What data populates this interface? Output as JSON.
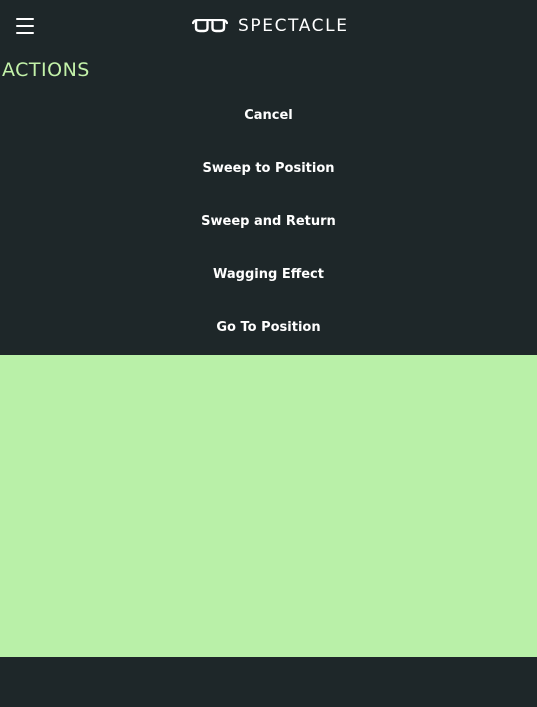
{
  "header": {
    "brand_name": "SPECTACLE",
    "menu_icon": "hamburger-menu-icon",
    "logo_icon": "glasses-logo-icon"
  },
  "section": {
    "title": "ACTIONS"
  },
  "actions": [
    {
      "label": "Cancel"
    },
    {
      "label": "Sweep to Position"
    },
    {
      "label": "Sweep and Return"
    },
    {
      "label": "Wagging Effect"
    },
    {
      "label": "Go To Position"
    }
  ],
  "colors": {
    "background": "#1e2729",
    "accent_text": "#c3f2a9",
    "panel": "#b9f0a8",
    "text": "#ffffff"
  }
}
